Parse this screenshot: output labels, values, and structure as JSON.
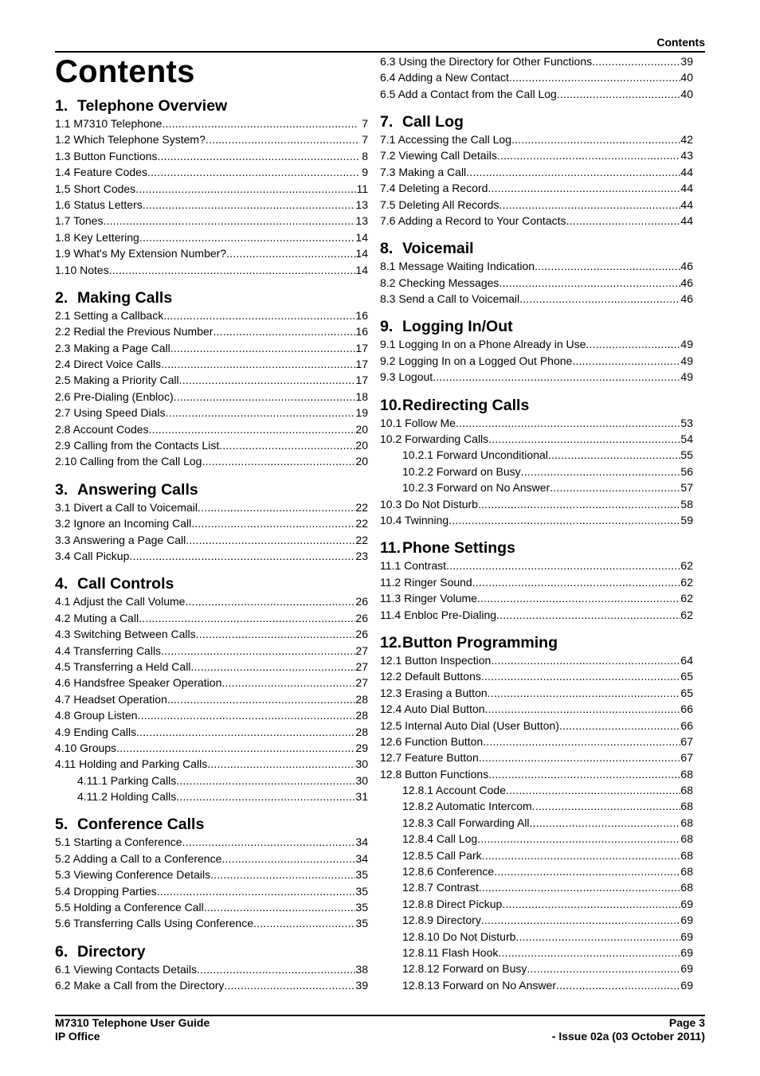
{
  "header": {
    "running_title": "Contents",
    "page_title": "Contents"
  },
  "footer": {
    "left1": "M7310 Telephone User Guide",
    "left2": "IP Office",
    "right1": "Page 3",
    "right2": "- Issue 02a (03 October 2011)"
  },
  "left_column": [
    {
      "num": "1.",
      "title": "Telephone Overview",
      "entries": [
        {
          "label": "1.1 M7310 Telephone",
          "page": "7"
        },
        {
          "label": "1.2 Which Telephone System?",
          "page": "7"
        },
        {
          "label": "1.3 Button Functions",
          "page": "8"
        },
        {
          "label": "1.4 Feature Codes",
          "page": "9"
        },
        {
          "label": "1.5 Short Codes",
          "page": "11"
        },
        {
          "label": "1.6 Status Letters",
          "page": "13"
        },
        {
          "label": "1.7 Tones",
          "page": "13"
        },
        {
          "label": "1.8 Key Lettering",
          "page": "14"
        },
        {
          "label": "1.9 What's My Extension Number?",
          "page": "14"
        },
        {
          "label": "1.10 Notes",
          "page": "14"
        }
      ]
    },
    {
      "num": "2.",
      "title": "Making Calls",
      "entries": [
        {
          "label": "2.1 Setting a Callback",
          "page": "16"
        },
        {
          "label": "2.2 Redial the Previous Number",
          "page": "16"
        },
        {
          "label": "2.3 Making a Page Call",
          "page": "17"
        },
        {
          "label": "2.4 Direct Voice Calls",
          "page": "17"
        },
        {
          "label": "2.5 Making a Priority Call",
          "page": "17"
        },
        {
          "label": "2.6 Pre-Dialing (Enbloc)",
          "page": "18"
        },
        {
          "label": "2.7 Using Speed Dials",
          "page": "19"
        },
        {
          "label": "2.8 Account Codes",
          "page": "20"
        },
        {
          "label": "2.9 Calling from the Contacts List",
          "page": "20"
        },
        {
          "label": "2.10 Calling from the Call Log",
          "page": "20"
        }
      ]
    },
    {
      "num": "3.",
      "title": "Answering Calls",
      "entries": [
        {
          "label": "3.1 Divert a Call to Voicemail",
          "page": "22"
        },
        {
          "label": "3.2 Ignore an Incoming Call",
          "page": "22"
        },
        {
          "label": "3.3 Answering a Page Call",
          "page": "22"
        },
        {
          "label": "3.4 Call Pickup",
          "page": "23"
        }
      ]
    },
    {
      "num": "4.",
      "title": "Call Controls",
      "entries": [
        {
          "label": "4.1 Adjust the Call Volume",
          "page": "26"
        },
        {
          "label": "4.2 Muting a Call",
          "page": "26"
        },
        {
          "label": "4.3 Switching Between Calls",
          "page": "26"
        },
        {
          "label": "4.4 Transferring Calls",
          "page": "27"
        },
        {
          "label": "4.5 Transferring a Held Call",
          "page": "27"
        },
        {
          "label": "4.6 Handsfree Speaker Operation",
          "page": "27"
        },
        {
          "label": "4.7 Headset Operation",
          "page": "28"
        },
        {
          "label": "4.8 Group Listen",
          "page": "28"
        },
        {
          "label": "4.9 Ending Calls",
          "page": "28"
        },
        {
          "label": "4.10 Groups",
          "page": "29"
        },
        {
          "label": "4.11 Holding and Parking Calls",
          "page": "30"
        },
        {
          "label": "4.11.1 Parking Calls",
          "page": "30",
          "indent": true
        },
        {
          "label": "4.11.2 Holding Calls",
          "page": "31",
          "indent": true
        }
      ]
    },
    {
      "num": "5.",
      "title": "Conference Calls",
      "entries": [
        {
          "label": "5.1 Starting a Conference",
          "page": "34"
        },
        {
          "label": "5.2 Adding a Call to a Conference",
          "page": "34"
        },
        {
          "label": "5.3 Viewing Conference Details",
          "page": "35"
        },
        {
          "label": "5.4 Dropping Parties",
          "page": "35"
        },
        {
          "label": "5.5 Holding a Conference Call",
          "page": "35"
        },
        {
          "label": "5.6 Transferring Calls Using Conference",
          "page": "35"
        }
      ]
    },
    {
      "num": "6.",
      "title": "Directory",
      "entries": [
        {
          "label": "6.1 Viewing Contacts Details",
          "page": "38"
        },
        {
          "label": "6.2 Make a Call from the Directory",
          "page": "39"
        }
      ]
    }
  ],
  "right_column": [
    {
      "num": "",
      "title": "",
      "entries": [
        {
          "label": "6.3 Using the Directory for Other Functions",
          "page": "39"
        },
        {
          "label": "6.4 Adding a New Contact",
          "page": "40"
        },
        {
          "label": "6.5 Add a Contact from the Call Log",
          "page": "40"
        }
      ]
    },
    {
      "num": "7.",
      "title": "Call Log",
      "entries": [
        {
          "label": "7.1 Accessing the Call Log",
          "page": "42"
        },
        {
          "label": "7.2 Viewing Call Details",
          "page": "43"
        },
        {
          "label": "7.3 Making a Call",
          "page": "44"
        },
        {
          "label": "7.4 Deleting a Record",
          "page": "44"
        },
        {
          "label": "7.5 Deleting All Records",
          "page": "44"
        },
        {
          "label": "7.6 Adding a Record to Your Contacts",
          "page": "44"
        }
      ]
    },
    {
      "num": "8.",
      "title": "Voicemail",
      "entries": [
        {
          "label": "8.1 Message Waiting Indication",
          "page": "46"
        },
        {
          "label": "8.2 Checking Messages",
          "page": "46"
        },
        {
          "label": "8.3 Send a Call to Voicemail",
          "page": "46"
        }
      ]
    },
    {
      "num": "9.",
      "title": "Logging In/Out",
      "entries": [
        {
          "label": "9.1 Logging In on a Phone Already in Use",
          "page": "49"
        },
        {
          "label": "9.2 Logging In on a Logged Out Phone",
          "page": "49"
        },
        {
          "label": "9.3 Logout",
          "page": "49"
        }
      ]
    },
    {
      "num": "10.",
      "title": "Redirecting Calls",
      "entries": [
        {
          "label": "10.1 Follow Me",
          "page": "53"
        },
        {
          "label": "10.2 Forwarding Calls",
          "page": "54"
        },
        {
          "label": "10.2.1 Forward Unconditional",
          "page": "55",
          "indent": true
        },
        {
          "label": "10.2.2 Forward on Busy",
          "page": "56",
          "indent": true
        },
        {
          "label": "10.2.3 Forward on No Answer",
          "page": "57",
          "indent": true
        },
        {
          "label": "10.3 Do Not Disturb",
          "page": "58"
        },
        {
          "label": "10.4 Twinning",
          "page": "59"
        }
      ]
    },
    {
      "num": "11.",
      "title": "Phone Settings",
      "entries": [
        {
          "label": "11.1 Contrast",
          "page": "62"
        },
        {
          "label": "11.2 Ringer Sound",
          "page": "62"
        },
        {
          "label": "11.3 Ringer Volume",
          "page": "62"
        },
        {
          "label": "11.4 Enbloc Pre-Dialing",
          "page": "62"
        }
      ]
    },
    {
      "num": "12.",
      "title": "Button Programming",
      "entries": [
        {
          "label": "12.1 Button Inspection",
          "page": "64"
        },
        {
          "label": "12.2 Default Buttons",
          "page": "65"
        },
        {
          "label": "12.3 Erasing a Button",
          "page": "65"
        },
        {
          "label": "12.4 Auto Dial Button",
          "page": "66"
        },
        {
          "label": "12.5 Internal Auto Dial (User Button)",
          "page": "66"
        },
        {
          "label": "12.6 Function Button",
          "page": "67"
        },
        {
          "label": "12.7 Feature Button",
          "page": "67"
        },
        {
          "label": "12.8 Button Functions",
          "page": "68"
        },
        {
          "label": "12.8.1 Account Code",
          "page": "68",
          "indent": true
        },
        {
          "label": "12.8.2 Automatic Intercom",
          "page": "68",
          "indent": true
        },
        {
          "label": "12.8.3 Call Forwarding All",
          "page": "68",
          "indent": true
        },
        {
          "label": "12.8.4 Call Log",
          "page": "68",
          "indent": true
        },
        {
          "label": "12.8.5 Call Park",
          "page": "68",
          "indent": true
        },
        {
          "label": "12.8.6 Conference",
          "page": "68",
          "indent": true
        },
        {
          "label": "12.8.7 Contrast",
          "page": "68",
          "indent": true
        },
        {
          "label": "12.8.8 Direct Pickup",
          "page": "69",
          "indent": true
        },
        {
          "label": "12.8.9 Directory",
          "page": "69",
          "indent": true
        },
        {
          "label": "12.8.10 Do Not Disturb",
          "page": "69",
          "indent": true
        },
        {
          "label": "12.8.11 Flash Hook",
          "page": "69",
          "indent": true
        },
        {
          "label": "12.8.12 Forward on Busy",
          "page": "69",
          "indent": true
        },
        {
          "label": "12.8.13 Forward on No Answer",
          "page": "69",
          "indent": true
        }
      ]
    }
  ]
}
